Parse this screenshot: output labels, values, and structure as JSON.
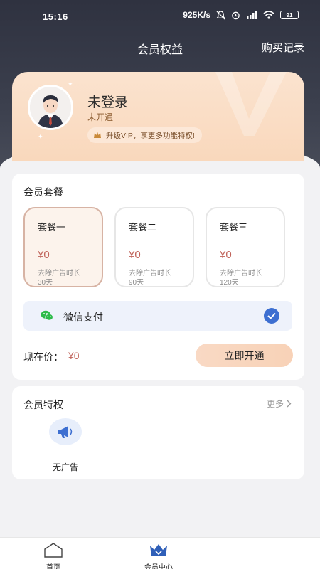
{
  "status_bar": {
    "time": "15:16",
    "network_speed": "925K/s",
    "battery": "91"
  },
  "header": {
    "title": "会员权益",
    "purchase_records": "购买记录"
  },
  "member_card": {
    "name": "未登录",
    "status": "未开通",
    "vip_tip": "升级VIP，享更多功能特权!"
  },
  "packages": {
    "title": "会员套餐",
    "plans": [
      {
        "name": "套餐一",
        "price": "¥0",
        "desc": "去除广告时长",
        "days": "30天",
        "selected": true
      },
      {
        "name": "套餐二",
        "price": "¥0",
        "desc": "去除广告时长",
        "days": "90天",
        "selected": false
      },
      {
        "name": "套餐三",
        "price": "¥0",
        "desc": "去除广告时长",
        "days": "120天",
        "selected": false
      }
    ],
    "payment_method": "微信支付",
    "current_price_label": "现在价：",
    "current_price_value": "¥0",
    "open_button": "立即开通"
  },
  "privileges": {
    "title": "会员特权",
    "more": "更多",
    "items": [
      {
        "label": "无广告",
        "icon": "megaphone-icon"
      }
    ]
  },
  "bottom_nav": [
    {
      "label": "首页",
      "icon": "home-icon",
      "active": false
    },
    {
      "label": "会员中心",
      "icon": "crown-icon",
      "active": true
    }
  ],
  "colors": {
    "accent_price": "#c0635a",
    "header_bg": "#2f3240",
    "card_bg": "#fbe3cf",
    "check_blue": "#3d6fd1"
  }
}
